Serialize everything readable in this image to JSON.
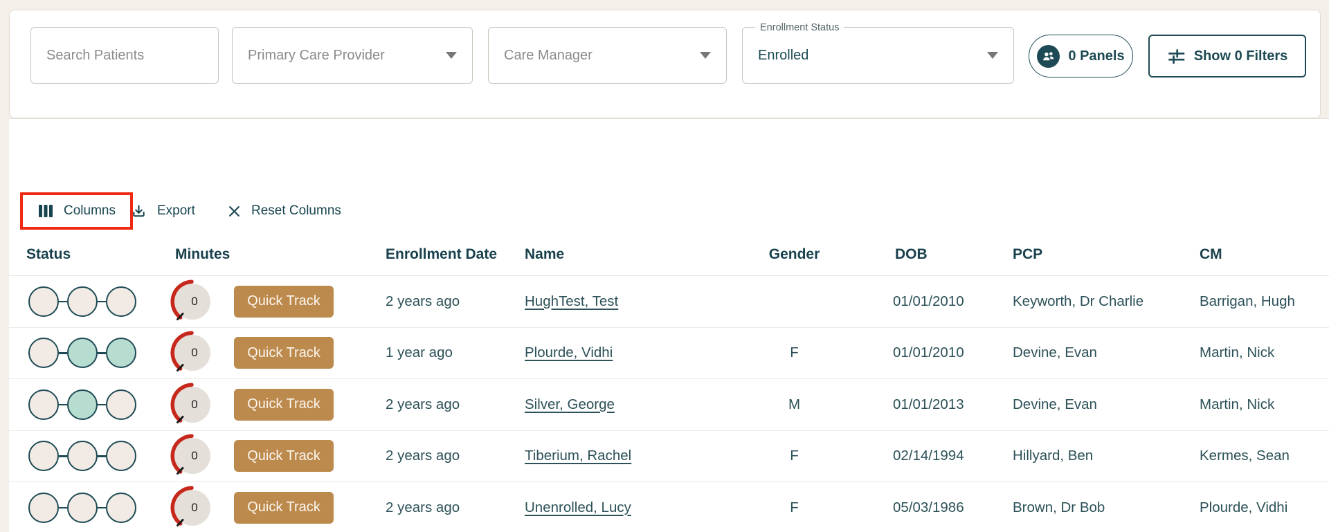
{
  "filters": {
    "search_placeholder": "Search Patients",
    "pcp_placeholder": "Primary Care Provider",
    "care_manager_placeholder": "Care Manager",
    "enrollment_status_label": "Enrollment Status",
    "enrollment_status_value": "Enrolled",
    "panels_button_label": "0 Panels",
    "show_filters_button_label": "Show 0 Filters"
  },
  "toolbar": {
    "columns_label": "Columns",
    "export_label": "Export",
    "reset_columns_label": "Reset Columns"
  },
  "table": {
    "headers": {
      "status": "Status",
      "minutes": "Minutes",
      "enrollment_date": "Enrollment Date",
      "name": "Name",
      "gender": "Gender",
      "dob": "DOB",
      "pcp": "PCP",
      "cm": "CM"
    },
    "quick_track_label": "Quick Track",
    "rows": [
      {
        "status_steps": [
          false,
          false,
          false
        ],
        "minutes": "0",
        "enrollment_date": "2 years ago",
        "name": "HughTest, Test",
        "gender": "",
        "dob": "01/01/2010",
        "pcp": "Keyworth, Dr Charlie",
        "cm": "Barrigan, Hugh"
      },
      {
        "status_steps": [
          false,
          true,
          true
        ],
        "minutes": "0",
        "enrollment_date": "1 year ago",
        "name": "Plourde, Vidhi",
        "gender": "F",
        "dob": "01/01/2010",
        "pcp": "Devine, Evan",
        "cm": "Martin, Nick"
      },
      {
        "status_steps": [
          false,
          true,
          false
        ],
        "minutes": "0",
        "enrollment_date": "2 years ago",
        "name": "Silver, George",
        "gender": "M",
        "dob": "01/01/2013",
        "pcp": "Devine, Evan",
        "cm": "Martin, Nick"
      },
      {
        "status_steps": [
          false,
          false,
          false
        ],
        "minutes": "0",
        "enrollment_date": "2 years ago",
        "name": "Tiberium, Rachel",
        "gender": "F",
        "dob": "02/14/1994",
        "pcp": "Hillyard, Ben",
        "cm": "Kermes, Sean"
      },
      {
        "status_steps": [
          false,
          false,
          false
        ],
        "minutes": "0",
        "enrollment_date": "2 years ago",
        "name": "Unenrolled, Lucy",
        "gender": "F",
        "dob": "05/03/1986",
        "pcp": "Brown, Dr Bob",
        "cm": "Plourde, Vidhi"
      }
    ]
  },
  "icons": {
    "panels": "people-group-icon",
    "show_filters": "sliders-icon",
    "columns": "columns-icon",
    "export": "download-icon",
    "reset_columns": "x-icon",
    "selects": "caret-down-icon"
  },
  "colors": {
    "teal_dark": "#1d4a54",
    "highlight_red": "#ee2a13",
    "quick_track_tan": "#bd8a4e",
    "gauge_red": "#c6281c",
    "step_filled": "#b7dcd0",
    "step_empty": "#f2eae5",
    "page_background": "#f4f0e9"
  }
}
